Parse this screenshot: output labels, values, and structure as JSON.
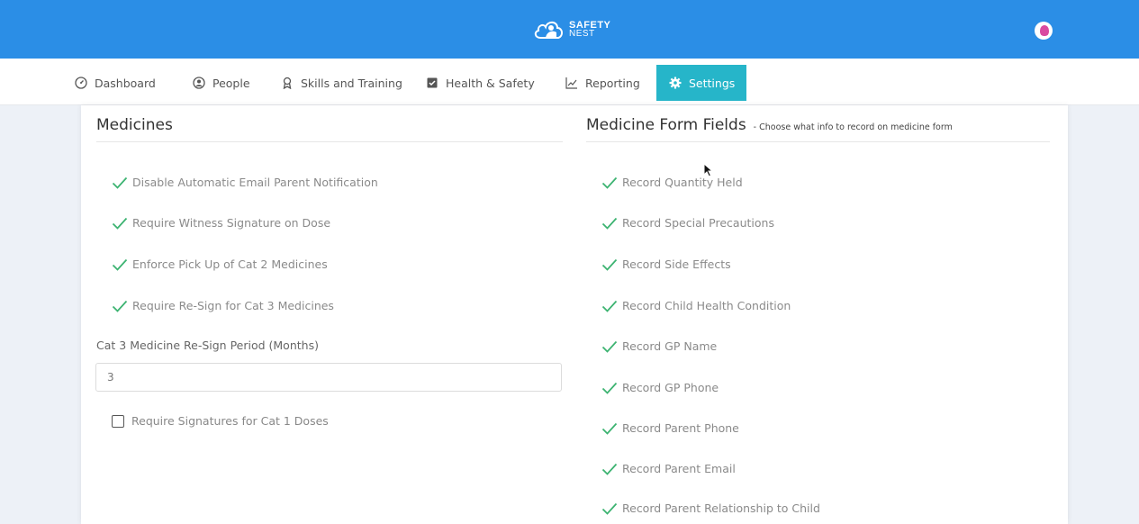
{
  "header": {
    "logo_line1": "SAFETY",
    "logo_line2": "NEST"
  },
  "nav": {
    "items": [
      {
        "label": "Dashboard",
        "icon": "dashboard-icon"
      },
      {
        "label": "People",
        "icon": "person-icon"
      },
      {
        "label": "Skills and Training",
        "icon": "award-icon"
      },
      {
        "label": "Health & Safety",
        "icon": "clipboard-check-icon"
      },
      {
        "label": "Reporting",
        "icon": "line-chart-icon"
      },
      {
        "label": "Settings",
        "icon": "gear-icon",
        "active": true
      }
    ]
  },
  "medicines": {
    "title": "Medicines",
    "options": [
      {
        "label": "Disable Automatic Email Parent Notification",
        "checked": true
      },
      {
        "label": "Require Witness Signature on Dose",
        "checked": true
      },
      {
        "label": "Enforce Pick Up of Cat 2 Medicines",
        "checked": true
      },
      {
        "label": "Require Re-Sign for Cat 3 Medicines",
        "checked": true
      }
    ],
    "resign_period_label": "Cat 3 Medicine Re-Sign Period (Months)",
    "resign_period_value": "3",
    "cat1_signature_label": "Require Signatures for Cat 1 Doses",
    "cat1_signature_checked": false
  },
  "form_fields": {
    "title": "Medicine Form Fields",
    "subtitle": "- Choose what info to record on medicine form",
    "items": [
      {
        "label": "Record Quantity Held",
        "checked": true
      },
      {
        "label": "Record Special Precautions",
        "checked": true
      },
      {
        "label": "Record Side Effects",
        "checked": true
      },
      {
        "label": "Record Child Health Condition",
        "checked": true
      },
      {
        "label": "Record GP Name",
        "checked": true
      },
      {
        "label": "Record GP Phone",
        "checked": true
      },
      {
        "label": "Record Parent Phone",
        "checked": true
      },
      {
        "label": "Record Parent Email",
        "checked": true
      },
      {
        "label": "Record Parent Relationship to Child",
        "checked": true
      }
    ]
  },
  "colors": {
    "header_blue": "#2b8ee6",
    "active_tab": "#26b5c9",
    "check_green": "#3cb371"
  }
}
